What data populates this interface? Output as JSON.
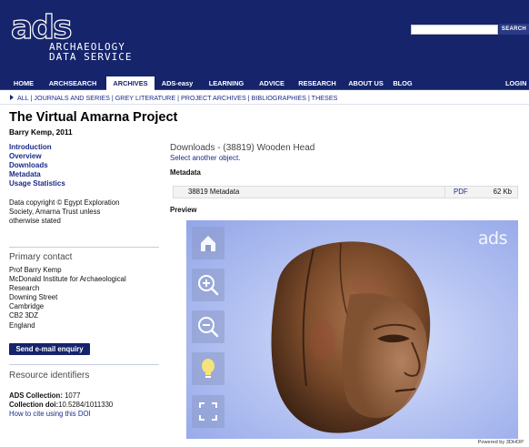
{
  "header": {
    "logo_word": "ads",
    "org_line1": "ARCHAEOLOGY",
    "org_line2": "DATA SERVICE",
    "search_placeholder": "",
    "search_button": "SEARCH"
  },
  "nav": {
    "items": [
      "HOME",
      "ARCHSEARCH",
      "ARCHIVES",
      "ADS-easy",
      "LEARNING",
      "ADVICE",
      "RESEARCH",
      "ABOUT US",
      "BLOG",
      "LOGIN"
    ],
    "active": "ARCHIVES"
  },
  "subnav": {
    "text": "ALL | JOURNALS AND SERIES | GREY LITERATURE | PROJECT ARCHIVES | BIBLIOGRAPHIES | THESES"
  },
  "page": {
    "title": "The Virtual Amarna Project",
    "subtitle": "Barry Kemp, 2011"
  },
  "sidebar": {
    "links": [
      "Introduction",
      "Overview",
      "Downloads",
      "Metadata",
      "Usage Statistics"
    ],
    "copyright_lines": [
      "Data copyright © Egypt Exploration",
      "Society, Amarna Trust unless",
      "otherwise stated"
    ],
    "primary_contact_heading": "Primary contact",
    "contact_lines": [
      "Prof Barry Kemp",
      "McDonald Institute for Archaeological",
      "Research",
      "Downing Street",
      "Cambridge",
      "CB2 3DZ",
      "England"
    ],
    "email_button": "Send e-mail enquiry",
    "resource_heading": "Resource identifiers",
    "ads_collection_label": "ADS Collection:",
    "ads_collection_value": "1077",
    "doi_label": "Collection doi:",
    "doi_value": "10.5284/1011330",
    "cite_link": "How to cite using this DOI"
  },
  "main": {
    "downloads_heading": "Downloads - (38819) Wooden Head",
    "select_link": "Select another object.",
    "metadata_heading": "Metadata",
    "metadata_row": {
      "name": "38819 Metadata",
      "format": "PDF",
      "size": "62 Kb"
    },
    "preview_heading": "Preview"
  },
  "viewer": {
    "logo": "ads",
    "tools": [
      "home-icon",
      "zoom-in-icon",
      "zoom-out-icon",
      "light-bulb-icon",
      "fullscreen-icon"
    ],
    "powered_by": "Powered by 3DHOP"
  },
  "colors": {
    "brand_navy": "#15246b",
    "link_blue": "#1a2b88",
    "viewer_bg": "#b9c6f3",
    "wood": "#7a4a2a"
  }
}
